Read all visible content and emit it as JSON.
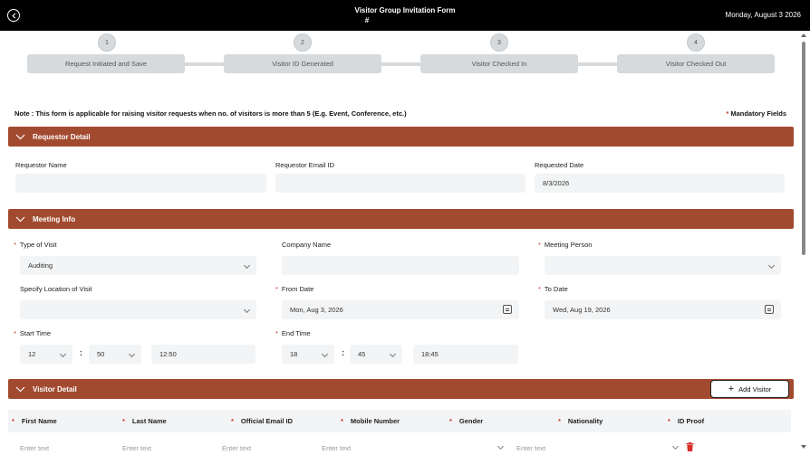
{
  "header": {
    "title": "Visitor Group Invitation Form",
    "title_hash": "#",
    "date": "Monday, August 3 2026"
  },
  "stepper": {
    "steps": [
      {
        "number": "1",
        "label": "Request Initiated and Save"
      },
      {
        "number": "2",
        "label": "Visitor ID Generated"
      },
      {
        "number": "3",
        "label": "Visitor Checked In"
      },
      {
        "number": "4",
        "label": "Visitor Checked Out"
      }
    ]
  },
  "note": "Note : This form is applicable for raising visitor requests when no. of visitors is more than 5 (E.g. Event, Conference, etc.)",
  "mandatory": {
    "star": "*",
    "text": " Mandatory Fields"
  },
  "sections": {
    "requestor": "Requestor Detail",
    "meeting": "Meeting Info",
    "visitor": "Visitor Detail"
  },
  "requestor": {
    "name_label": "Requestor Name",
    "name_value": "",
    "email_label": "Requestor Email ID",
    "email_value": "",
    "date_label": "Requested Date",
    "date_value": "8/3/2026"
  },
  "meeting": {
    "type_label": "Type of Visit",
    "type_value": "Auditing",
    "company_label": "Company Name",
    "company_value": "",
    "person_label": "Meeting Person",
    "person_value": "",
    "location_label": "Specify Location of Visit",
    "location_value": "",
    "from_label": "From Date",
    "from_value": "Mon, Aug 3, 2026",
    "to_label": "To Date",
    "to_value": "Wed, Aug 19, 2026",
    "start_label": "Start Time",
    "start_hour": "12",
    "start_minute": "50",
    "start_display": "12:50",
    "end_label": "End Time",
    "end_hour": "18",
    "end_minute": "45",
    "end_display": "18:45",
    "colon": ":"
  },
  "visitor": {
    "add_label": "Add Visitor",
    "add_icon": "+",
    "columns": [
      "First Name",
      "Last Name",
      "Official Email ID",
      "Mobile Number",
      "Gender",
      "Nationality",
      "ID Proof"
    ],
    "row_placeholder": "Enter text"
  },
  "colors": {
    "section_bar": "#a24a2f",
    "required": "#c0392b",
    "topbar": "#000000"
  },
  "icons": {
    "back": "back-arrow-icon",
    "section": "chevron-down-icon",
    "calendar": "calendar-icon",
    "add": "plus-icon",
    "delete": "trash-icon"
  }
}
